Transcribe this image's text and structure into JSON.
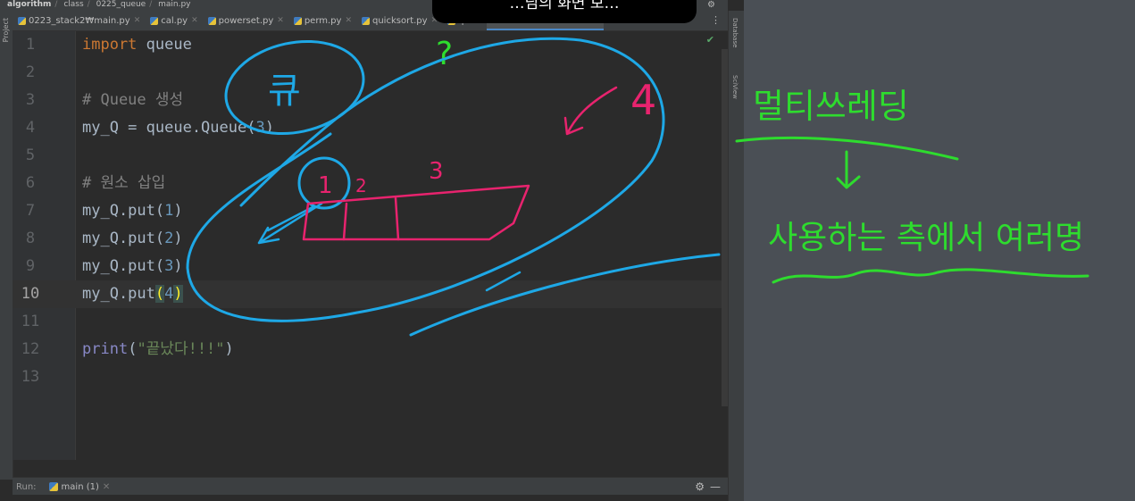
{
  "breadcrumb": [
    "algorithm",
    "class",
    "0225_queue",
    "main.py"
  ],
  "side_labels": {
    "project": "Project",
    "database": "Database",
    "sciview": "SciView"
  },
  "tabs": [
    {
      "label": "0223_stack2₩main.py"
    },
    {
      "label": "cal.py"
    },
    {
      "label": "powerset.py"
    },
    {
      "label": "perm.py"
    },
    {
      "label": "quicksort.py"
    },
    {
      "label": "quick"
    },
    {
      "label": ""
    }
  ],
  "toast": "…님의 화면 보…",
  "editor": {
    "current_line": 10,
    "lines": [
      {
        "n": "1"
      },
      {
        "n": "2"
      },
      {
        "n": "3"
      },
      {
        "n": "4"
      },
      {
        "n": "5"
      },
      {
        "n": "6"
      },
      {
        "n": "7"
      },
      {
        "n": "8"
      },
      {
        "n": "9"
      },
      {
        "n": "10"
      },
      {
        "n": "11"
      },
      {
        "n": "12"
      },
      {
        "n": "13"
      }
    ],
    "code": {
      "l1_kw": "import",
      "l1_rest": " queue",
      "l3": "# Queue 생성",
      "l4_a": "my_Q = queue.Queue(",
      "l4_num": "3",
      "l4_b": ")",
      "l6": "# 원소 삽입",
      "l7_a": "my_Q.put(",
      "l7_num": "1",
      "l7_b": ")",
      "l8_a": "my_Q.put(",
      "l8_num": "2",
      "l8_b": ")",
      "l9_a": "my_Q.put(",
      "l9_num": "3",
      "l9_b": ")",
      "l10_a": "my_Q.put",
      "l10_open": "(",
      "l10_num": "4",
      "l10_close": ")",
      "l12_fn": "print",
      "l12_a": "(",
      "l12_str": "\"끝났다!!!\"",
      "l12_b": ")"
    }
  },
  "run": {
    "label": "Run:",
    "tab": "main (1)"
  },
  "annotations": {
    "blue_circle_text": "큐",
    "pink_number_4": "4",
    "pink_number_3": "3",
    "pink_number_2": "2",
    "blue_number_1": "1",
    "green_question": "?",
    "green_title": "멀티쓰레딩",
    "green_subtitle": "사용하는 측에서 여러명"
  },
  "colors": {
    "annotation_blue": "#1ea8e6",
    "annotation_pink": "#e8236e",
    "annotation_green": "#2edc2e"
  }
}
